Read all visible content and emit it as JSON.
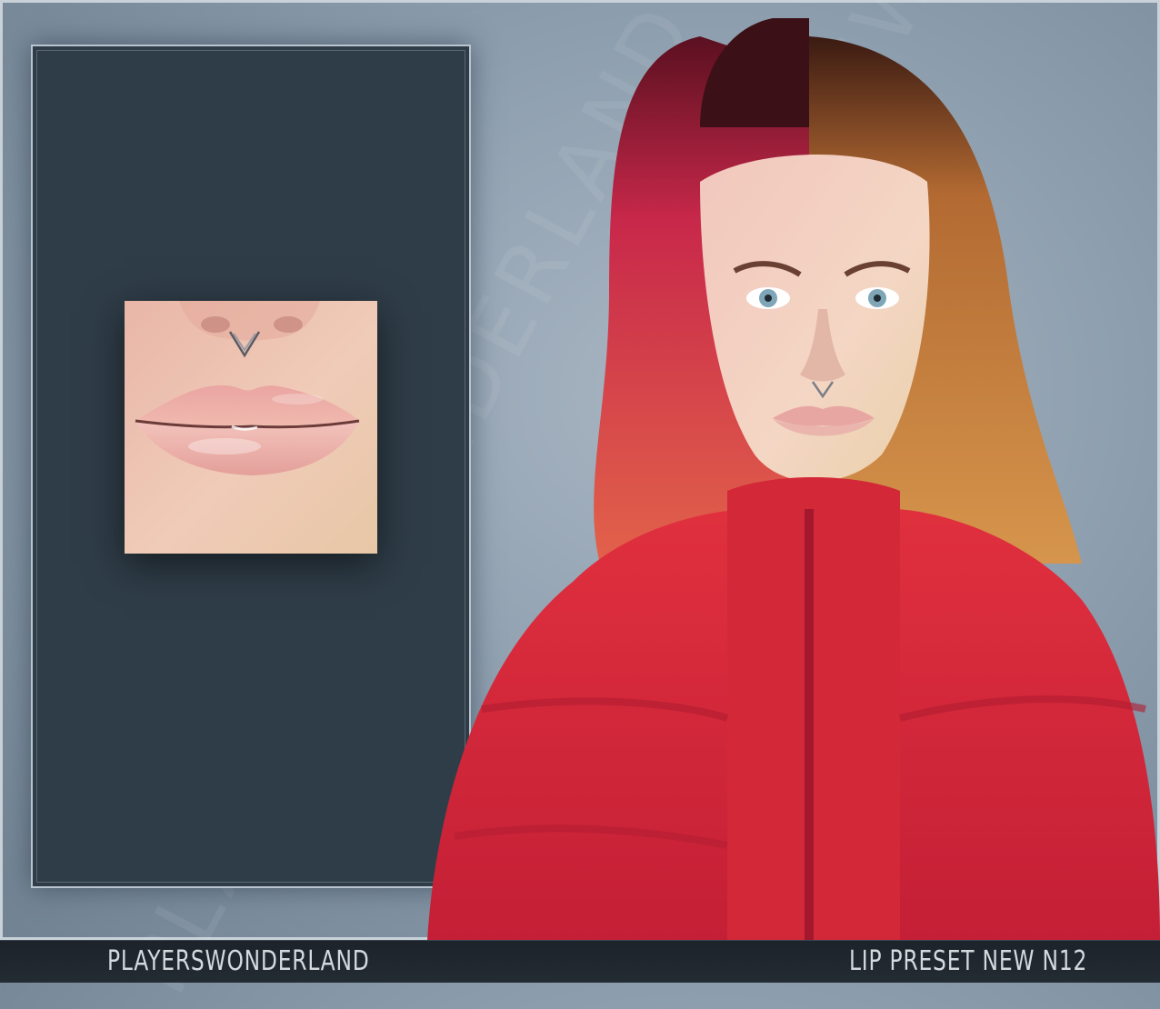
{
  "watermark": {
    "text": "PLAYERSWONDERLAND"
  },
  "caption": {
    "brand": "PLAYERSWONDERLAND",
    "item_name": "LIP PRESET NEW N12"
  },
  "colors": {
    "panel": "#2f3d48",
    "jacket": "#d8263a",
    "caption_bar": "#1f262d",
    "caption_text": "#d4d9de"
  }
}
